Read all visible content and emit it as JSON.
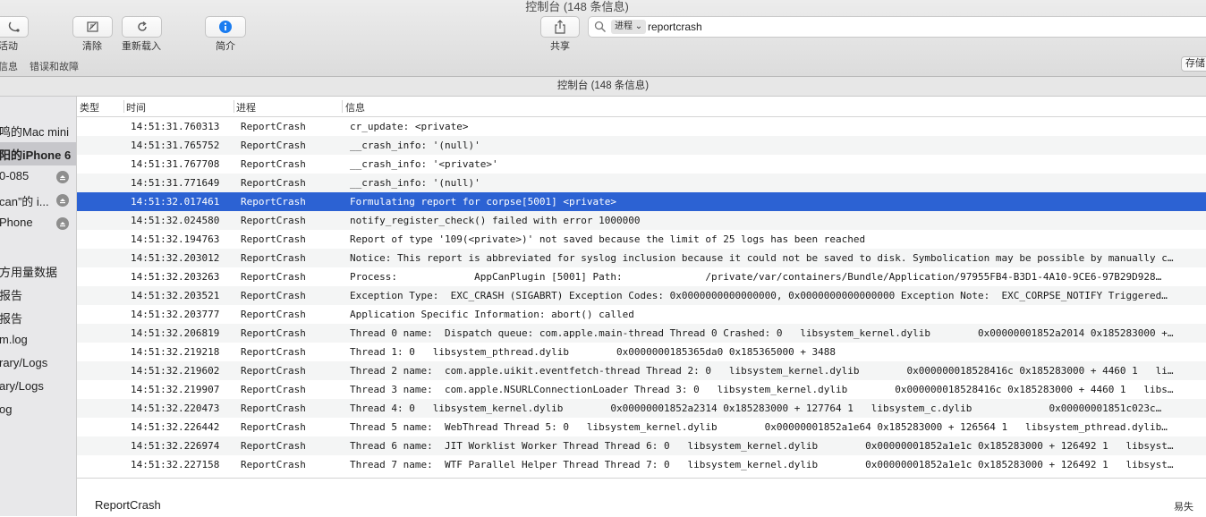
{
  "window": {
    "title": "控制台 (148 条信息)"
  },
  "toolbar": {
    "activity_label": "活动",
    "clear_label": "清除",
    "reload_label": "重新载入",
    "info_label": "简介",
    "share_label": "共享",
    "scope_info": "信息",
    "scope_errors": "错误和故障",
    "save_label": "存储"
  },
  "search": {
    "token_label": "进程",
    "query": "reportcrash"
  },
  "subheader": {
    "title": "控制台 (148 条信息)"
  },
  "sidebar": {
    "items": [
      {
        "label": "鸣的Mac mini"
      },
      {
        "label": "阳的iPhone 6"
      },
      {
        "label": "0-085"
      },
      {
        "label": "can”的 i..."
      },
      {
        "label": "Phone"
      },
      {
        "label": "方用量数据"
      },
      {
        "label": "报告"
      },
      {
        "label": "报告"
      },
      {
        "label": "m.log"
      },
      {
        "label": "rary/Logs"
      },
      {
        "label": "ary/Logs"
      },
      {
        "label": "og"
      }
    ]
  },
  "table": {
    "headers": {
      "type": "类型",
      "time": "时间",
      "process": "进程",
      "message": "信息"
    },
    "rows": [
      {
        "time": "14:51:31.760313",
        "process": "ReportCrash",
        "message": "cr_update: <private>"
      },
      {
        "time": "14:51:31.765752",
        "process": "ReportCrash",
        "message": "__crash_info: '(null)'"
      },
      {
        "time": "14:51:31.767708",
        "process": "ReportCrash",
        "message": "__crash_info: '<private>'"
      },
      {
        "time": "14:51:31.771649",
        "process": "ReportCrash",
        "message": "__crash_info: '(null)'"
      },
      {
        "time": "14:51:32.017461",
        "process": "ReportCrash",
        "message": "Formulating report for corpse[5001] <private>"
      },
      {
        "time": "14:51:32.024580",
        "process": "ReportCrash",
        "message": "notify_register_check() failed with error 1000000"
      },
      {
        "time": "14:51:32.194763",
        "process": "ReportCrash",
        "message": "Report of type '109(<private>)' not saved because the limit of 25 logs has been reached"
      },
      {
        "time": "14:51:32.203012",
        "process": "ReportCrash",
        "message": "Notice: This report is abbreviated for syslog inclusion because it could not be saved to disk. Symbolication may be possible by manually c…"
      },
      {
        "time": "14:51:32.203263",
        "process": "ReportCrash",
        "message": "Process:             AppCanPlugin [5001] Path:              /private/var/containers/Bundle/Application/97955FB4-B3D1-4A10-9CE6-97B29D928…"
      },
      {
        "time": "14:51:32.203521",
        "process": "ReportCrash",
        "message": "Exception Type:  EXC_CRASH (SIGABRT) Exception Codes: 0x0000000000000000, 0x0000000000000000 Exception Note:  EXC_CORPSE_NOTIFY Triggered…"
      },
      {
        "time": "14:51:32.203777",
        "process": "ReportCrash",
        "message": "Application Specific Information: abort() called"
      },
      {
        "time": "14:51:32.206819",
        "process": "ReportCrash",
        "message": "Thread 0 name:  Dispatch queue: com.apple.main-thread Thread 0 Crashed: 0   libsystem_kernel.dylib        0x00000001852a2014 0x185283000 +…"
      },
      {
        "time": "14:51:32.219218",
        "process": "ReportCrash",
        "message": "Thread 1: 0   libsystem_pthread.dylib        0x0000000185365da0 0x185365000 + 3488"
      },
      {
        "time": "14:51:32.219602",
        "process": "ReportCrash",
        "message": "Thread 2 name:  com.apple.uikit.eventfetch-thread Thread 2: 0   libsystem_kernel.dylib        0x000000018528416c 0x185283000 + 4460 1   li…"
      },
      {
        "time": "14:51:32.219907",
        "process": "ReportCrash",
        "message": "Thread 3 name:  com.apple.NSURLConnectionLoader Thread 3: 0   libsystem_kernel.dylib        0x000000018528416c 0x185283000 + 4460 1   libs…"
      },
      {
        "time": "14:51:32.220473",
        "process": "ReportCrash",
        "message": "Thread 4: 0   libsystem_kernel.dylib        0x00000001852a2314 0x185283000 + 127764 1   libsystem_c.dylib             0x00000001851c023c…"
      },
      {
        "time": "14:51:32.226442",
        "process": "ReportCrash",
        "message": "Thread 5 name:  WebThread Thread 5: 0   libsystem_kernel.dylib        0x00000001852a1e64 0x185283000 + 126564 1   libsystem_pthread.dylib…"
      },
      {
        "time": "14:51:32.226974",
        "process": "ReportCrash",
        "message": "Thread 6 name:  JIT Worklist Worker Thread Thread 6: 0   libsystem_kernel.dylib        0x00000001852a1e1c 0x185283000 + 126492 1   libsyst…"
      },
      {
        "time": "14:51:32.227158",
        "process": "ReportCrash",
        "message": "Thread 7 name:  WTF Parallel Helper Thread Thread 7: 0   libsystem_kernel.dylib        0x00000001852a1e1c 0x185283000 + 126492 1   libsyst…"
      }
    ],
    "selected_index": 4
  },
  "detail": {
    "process": "ReportCrash",
    "right_label": "易失"
  },
  "colors": {
    "selection": "#2c62d3",
    "info_accent": "#1a7cf0"
  }
}
